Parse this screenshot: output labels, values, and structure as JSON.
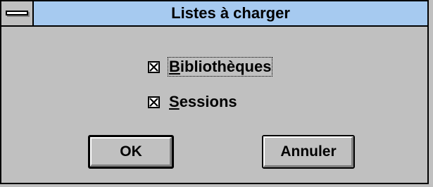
{
  "dialog": {
    "title": "Listes à charger",
    "system_menu_icon": "system-menu-icon"
  },
  "options": [
    {
      "prefix": "",
      "accel": "B",
      "rest": "ibliothèques",
      "checked": true,
      "focused": true
    },
    {
      "prefix": "",
      "accel": "S",
      "rest": "essions",
      "checked": true,
      "focused": false
    }
  ],
  "buttons": {
    "ok_label": "OK",
    "cancel_label": "Annuler"
  },
  "colors": {
    "face": "#c0c0c0",
    "title_bar": "#a6caf0",
    "border": "#000000"
  }
}
